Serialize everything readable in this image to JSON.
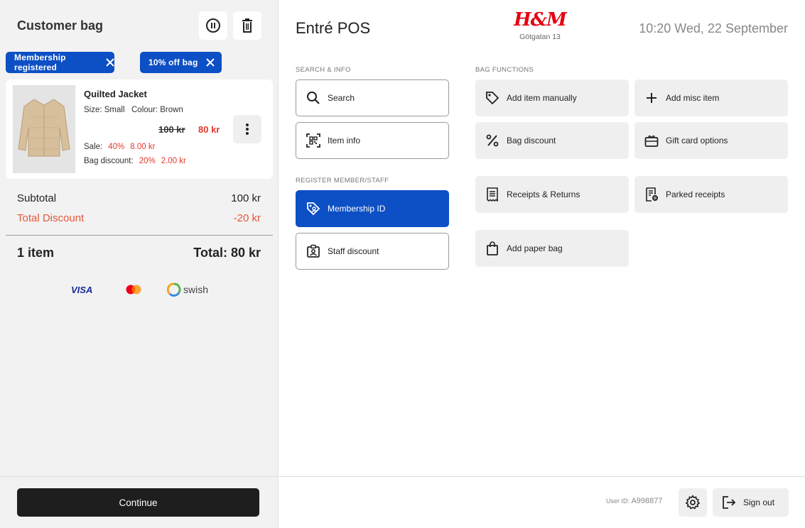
{
  "bag": {
    "title": "Customer bag",
    "chips": [
      {
        "label": "Membership registered"
      },
      {
        "label": "10% off bag"
      }
    ],
    "item": {
      "name": "Quilted Jacket",
      "size": "Size: Small",
      "colour": "Colour: Brown",
      "old_price": "100  kr",
      "new_price": "80 kr",
      "sale_label": "Sale:",
      "sale_pct": "40%",
      "sale_amount": "8.00 kr",
      "bag_label": "Bag discount:",
      "bag_pct": "20%",
      "bag_amount": "2.00 kr"
    },
    "subtotal_label": "Subtotal",
    "subtotal_value": "100 kr",
    "discount_label": "Total Discount",
    "discount_value": "-20 kr",
    "count": "1 item",
    "total": "Total: 80 kr",
    "payments": [
      "VISA",
      "swish"
    ],
    "continue_label": "Continue"
  },
  "header": {
    "app_title": "Entré POS",
    "logo_text": "H&M",
    "store": "Götgatan 13",
    "datetime": "10:20 Wed, 22 September"
  },
  "sections": {
    "search_info": "SEARCH & INFO",
    "register": "REGISTER MEMBER/STAFF",
    "bag_functions": "BAG FUNCTIONS"
  },
  "buttons": {
    "search": "Search",
    "item_info": "Item info",
    "membership": "Membership ID",
    "staff": "Staff discount",
    "add_item": "Add item manually",
    "add_misc": "Add misc item",
    "bag_discount": "Bag discount",
    "gift_card": "Gift card options",
    "receipts": "Receipts & Returns",
    "parked": "Parked receipts",
    "paper_bag": "Add paper bag"
  },
  "footer": {
    "user_label": "User ID:",
    "user_id": "A998877",
    "sign_out": "Sign out"
  },
  "colors": {
    "primary_blue": "#0d4fc4",
    "discount_red": "#e3392b",
    "brand_red": "#e50010"
  }
}
